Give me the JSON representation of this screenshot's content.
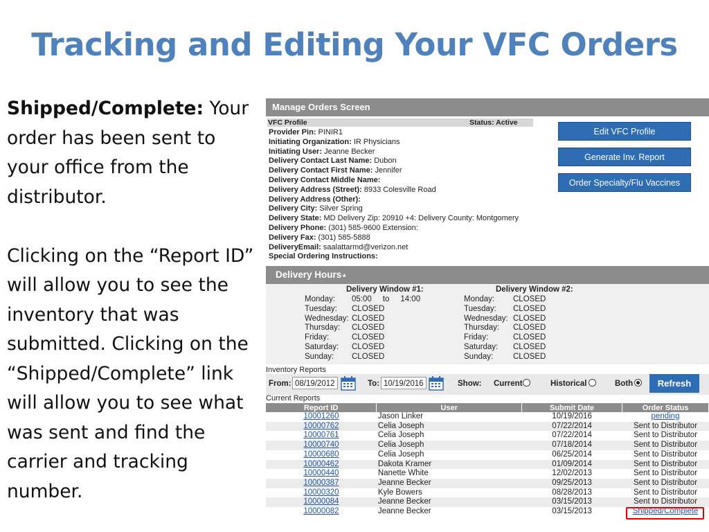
{
  "slide": {
    "title": "Tracking and Editing Your VFC Orders",
    "bold_lead": "Shipped/Complete:",
    "lead_rest": " Your order has been sent to your office from the distributor.",
    "paragraph2": "Clicking on the “Report ID” will allow you to see the inventory that was submitted. Clicking on the “Shipped/Complete” link will allow you to see what was sent and find the carrier and tracking number."
  },
  "screen": {
    "header": "Manage Orders Screen",
    "profile_title": "VFC Profile",
    "status_label": "Status: Active",
    "profile_lines": [
      {
        "label": "Provider Pin:",
        "value": " PINIR1"
      },
      {
        "label": "Initiating Organization:",
        "value": " IR Physicians"
      },
      {
        "label": "Initiating User:",
        "value": " Jeanne Becker"
      },
      {
        "label": "Delivery Contact Last Name:",
        "value": " Dubon"
      },
      {
        "label": "Delivery Contact First Name:",
        "value": " Jennifer"
      },
      {
        "label": "Delivery Contact Middle Name:",
        "value": ""
      },
      {
        "label": "Delivery Address (Street):",
        "value": " 8933 Colesville Road"
      },
      {
        "label": "Delivery Address (Other):",
        "value": ""
      },
      {
        "label": "Delivery City:",
        "value": " Silver Spring"
      },
      {
        "label": "Delivery State:",
        "value": " MD Delivery Zip: 20910 +4: Delivery County: Montgomery"
      },
      {
        "label": "Delivery Phone:",
        "value": " (301) 585-9600 Extension:"
      },
      {
        "label": "Delivery Fax:",
        "value": " (301) 585-5888"
      },
      {
        "label": "DeliveryEmail:",
        "value": " saalattarmd@verizon.net"
      },
      {
        "label": "Special Ordering Instructions:",
        "value": ""
      }
    ],
    "buttons": {
      "edit_profile": "Edit VFC Profile",
      "generate_report": "Generate Inv. Report",
      "order_specialty": "Order Specialty/Flu Vaccines"
    },
    "delivery_hours": {
      "title": "Delivery Hours",
      "window1_title": "Delivery Window #1:",
      "window2_title": "Delivery Window #2:",
      "window1": [
        {
          "day": "Monday:",
          "value": "05:00     to     14:00"
        },
        {
          "day": "Tuesday:",
          "value": "CLOSED"
        },
        {
          "day": "Wednesday:",
          "value": "CLOSED"
        },
        {
          "day": "Thursday:",
          "value": "CLOSED"
        },
        {
          "day": "Friday:",
          "value": "CLOSED"
        },
        {
          "day": "Saturday:",
          "value": "CLOSED"
        },
        {
          "day": "Sunday:",
          "value": "CLOSED"
        }
      ],
      "window2": [
        {
          "day": "Monday:",
          "value": "CLOSED"
        },
        {
          "day": "Tuesday:",
          "value": "CLOSED"
        },
        {
          "day": "Wednesday:",
          "value": "CLOSED"
        },
        {
          "day": "Thursday:",
          "value": "CLOSED"
        },
        {
          "day": "Friday:",
          "value": "CLOSED"
        },
        {
          "day": "Saturday:",
          "value": "CLOSED"
        },
        {
          "day": "Sunday:",
          "value": "CLOSED"
        }
      ]
    },
    "inventory": {
      "label": "Inventory Reports",
      "from_label": "From:",
      "from_value": "08/19/2012",
      "to_label": "To:",
      "to_value": "10/19/2016",
      "show_label": "Show:",
      "current_label": "Current",
      "historical_label": "Historical",
      "both_label": "Both",
      "refresh_label": "Refresh"
    },
    "current_reports": {
      "label": "Current Reports",
      "columns": [
        "Report ID",
        "User",
        "Submit Date",
        "Order Status"
      ],
      "rows": [
        {
          "id": "10001260",
          "user": "Jason Linker",
          "date": "10/19/2016",
          "status": "pending",
          "status_link": true
        },
        {
          "id": "10000762",
          "user": "Celia Joseph",
          "date": "07/22/2014",
          "status": "Sent to Distributor",
          "status_link": false
        },
        {
          "id": "10000761",
          "user": "Celia Joseph",
          "date": "07/22/2014",
          "status": "Sent to Distributor",
          "status_link": false
        },
        {
          "id": "10000740",
          "user": "Celia Joseph",
          "date": "07/18/2014",
          "status": "Sent to Distributor",
          "status_link": false
        },
        {
          "id": "10000680",
          "user": "Celia Joseph",
          "date": "06/25/2014",
          "status": "Sent to Distributor",
          "status_link": false
        },
        {
          "id": "10000462",
          "user": "Dakota Kramer",
          "date": "01/09/2014",
          "status": "Sent to Distributor",
          "status_link": false
        },
        {
          "id": "10000440",
          "user": "Nanette White",
          "date": "12/02/2013",
          "status": "Sent to Distributor",
          "status_link": false
        },
        {
          "id": "10000387",
          "user": "Jeanne Becker",
          "date": "09/25/2013",
          "status": "Sent to Distributor",
          "status_link": false
        },
        {
          "id": "10000320",
          "user": "Kyle Bowers",
          "date": "08/28/2013",
          "status": "Sent to Distributor",
          "status_link": false
        },
        {
          "id": "10000084",
          "user": "Jeanne Becker",
          "date": "03/15/2013",
          "status": "Sent to Distributor",
          "status_link": false
        },
        {
          "id": "10000082",
          "user": "Jeanne Becker",
          "date": "03/15/2013",
          "status": "Shipped/Complete",
          "status_link": true
        }
      ]
    },
    "colors": {
      "title": "#4f81bd",
      "button": "#2e6db4",
      "header_gray": "#8c8c8c",
      "highlight": "#e00000",
      "link": "#2255aa"
    }
  }
}
